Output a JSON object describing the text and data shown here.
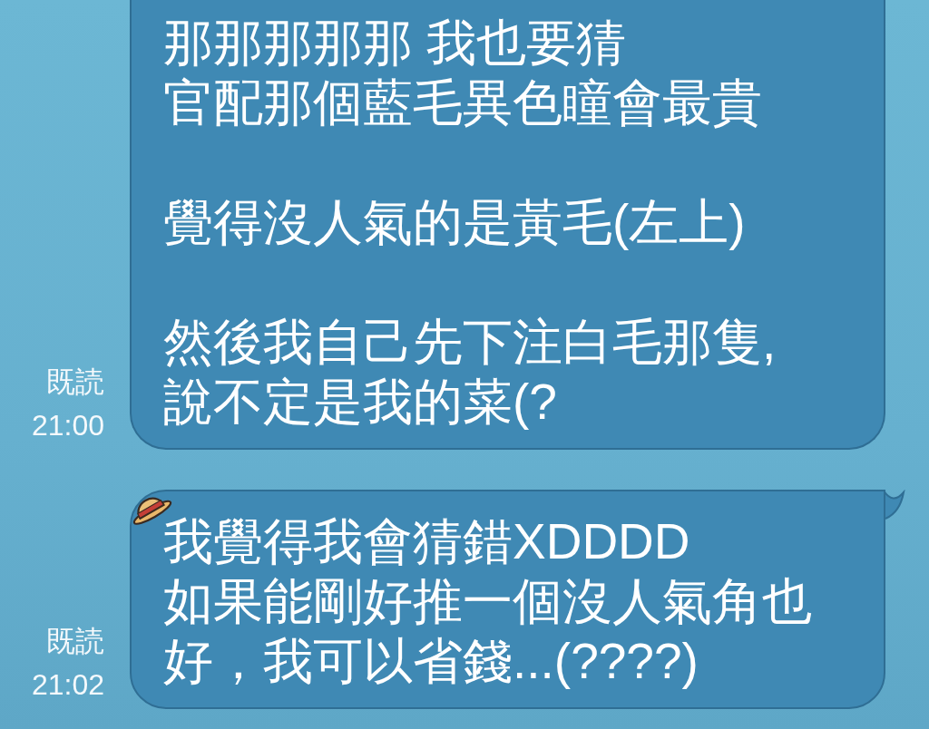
{
  "messages": [
    {
      "read_label": "既読",
      "time": "21:00",
      "tail": false,
      "paragraphs": [
        {
          "lines": [
            "那那那那那 我也要猜",
            "官配那個藍毛異色瞳會最貴"
          ]
        },
        {
          "lines": [
            "覺得沒人氣的是黃毛(左上)"
          ]
        },
        {
          "lines": [
            "然後我自己先下注白毛那隻,",
            "說不定是我的菜(?"
          ]
        }
      ]
    },
    {
      "read_label": "既読",
      "time": "21:02",
      "tail": true,
      "paragraphs": [
        {
          "lines": [
            "我覺得我會猜錯XDDDD",
            "如果能剛好推一個沒人氣角也好，我可以省錢...(????)"
          ]
        }
      ]
    }
  ]
}
